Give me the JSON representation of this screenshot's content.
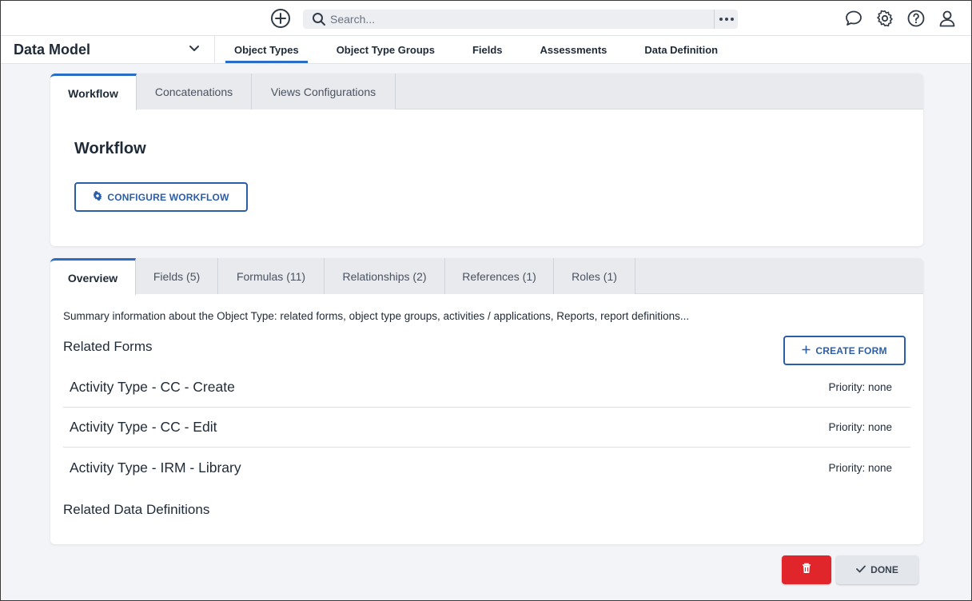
{
  "topbar": {
    "add_icon": "plus-circle-icon",
    "search": {
      "placeholder": "Search..."
    },
    "icons": [
      "chat-icon",
      "gear-icon",
      "help-icon",
      "user-icon"
    ]
  },
  "nav": {
    "data_model_label": "Data Model",
    "tabs": [
      {
        "label": "Object Types",
        "active": true
      },
      {
        "label": "Object Type Groups",
        "active": false
      },
      {
        "label": "Fields",
        "active": false
      },
      {
        "label": "Assessments",
        "active": false
      },
      {
        "label": "Data Definition",
        "active": false
      }
    ]
  },
  "workflow_card": {
    "tabs": [
      {
        "label": "Workflow",
        "active": true
      },
      {
        "label": "Concatenations",
        "active": false
      },
      {
        "label": "Views Configurations",
        "active": false
      }
    ],
    "title": "Workflow",
    "configure_button": "CONFIGURE WORKFLOW"
  },
  "overview_card": {
    "tabs": [
      {
        "label": "Overview",
        "active": true
      },
      {
        "label": "Fields (5)",
        "active": false
      },
      {
        "label": "Formulas (11)",
        "active": false
      },
      {
        "label": "Relationships (2)",
        "active": false
      },
      {
        "label": "References (1)",
        "active": false
      },
      {
        "label": "Roles (1)",
        "active": false
      }
    ],
    "summary": "Summary information about the Object Type: related forms, object type groups, activities / applications, Reports, report definitions...",
    "related_forms_title": "Related Forms",
    "create_form_button": "CREATE FORM",
    "forms": [
      {
        "name": "Activity Type - CC - Create",
        "priority": "Priority: none"
      },
      {
        "name": "Activity Type - CC - Edit",
        "priority": "Priority: none"
      },
      {
        "name": "Activity Type - IRM - Library",
        "priority": "Priority: none"
      }
    ],
    "related_data_definitions_title": "Related Data Definitions"
  },
  "footer": {
    "delete_icon": "trash-icon",
    "done_button": "DONE"
  },
  "colors": {
    "accent": "#2b6cc4",
    "danger": "#e0262b"
  }
}
